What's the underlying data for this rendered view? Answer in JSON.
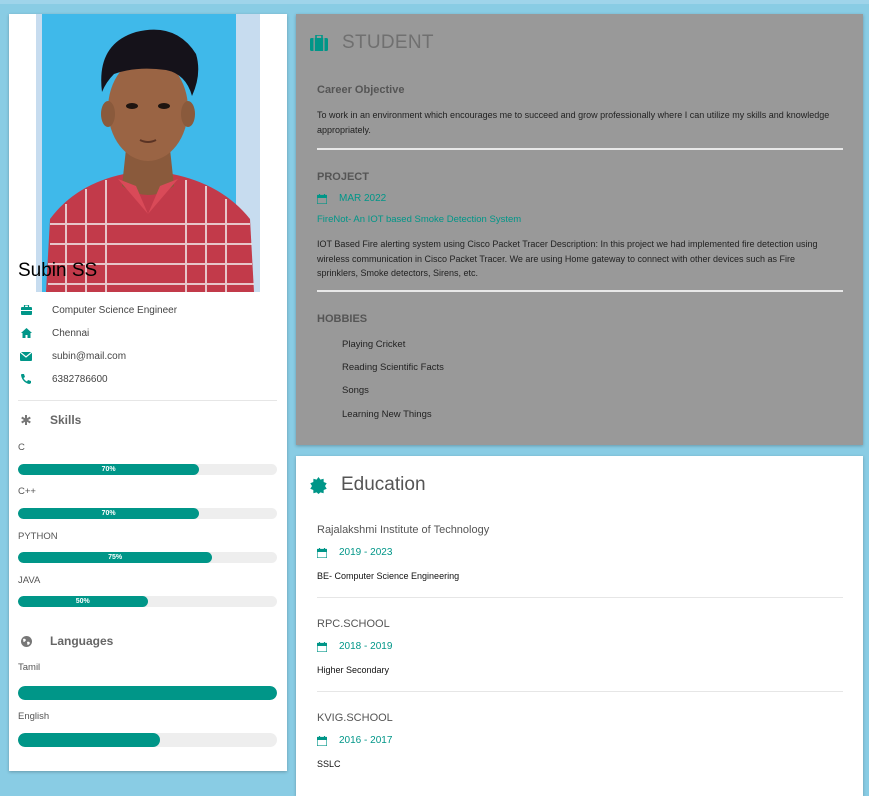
{
  "profile": {
    "name": "Subin SS",
    "role": "Computer Science Engineer",
    "location": "Chennai",
    "email": "subin@mail.com",
    "phone": "6382786600",
    "photo_icon": "profile-photo"
  },
  "skills": {
    "title": "Skills",
    "items": [
      {
        "name": "C",
        "level": 70,
        "label": "70%"
      },
      {
        "name": "C++",
        "level": 70,
        "label": "70%"
      },
      {
        "name": "PYTHON",
        "level": 75,
        "label": "75%"
      },
      {
        "name": "JAVA",
        "level": 50,
        "label": "50%"
      }
    ]
  },
  "languages": {
    "title": "Languages",
    "items": [
      {
        "name": "Tamil",
        "level": 100
      },
      {
        "name": "English",
        "level": 55
      }
    ]
  },
  "work": {
    "title": "STUDENT",
    "objective_heading": "Career Objective",
    "objective_text": "To work in an environment which encourages me to succeed and grow professionally where I can utilize my skills and knowledge appropriately.",
    "project_heading": "PROJECT",
    "project_date": "MAR 2022",
    "project_title": "FireNot- An IOT based Smoke Detection System",
    "project_text": "IOT Based Fire alerting system using Cisco Packet Tracer Description: In this project we had implemented fire detection using wireless communication in Cisco Packet Tracer. We are using Home gateway to connect with other devices such as Fire sprinklers, Smoke detectors, Sirens, etc.",
    "hobbies_heading": "HOBBIES",
    "hobbies": [
      "Playing Cricket",
      "Reading Scientific Facts",
      "Songs",
      "Learning New Things"
    ]
  },
  "education": {
    "title": "Education",
    "items": [
      {
        "school": "Rajalakshmi Institute of Technology",
        "years": "2019 - 2023",
        "degree": "BE- Computer Science Engineering"
      },
      {
        "school": "RPC.SCHOOL",
        "years": "2018 - 2019",
        "degree": "Higher Secondary"
      },
      {
        "school": "KVIG.SCHOOL",
        "years": "2016 - 2017",
        "degree": "SSLC"
      }
    ]
  },
  "colors": {
    "accent": "#009688",
    "background": "#89cce4",
    "work_card": "#999999"
  }
}
